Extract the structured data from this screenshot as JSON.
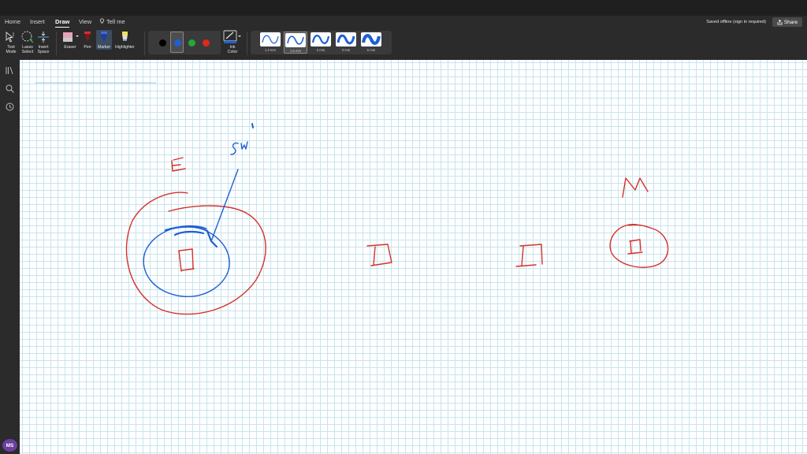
{
  "menu": {
    "tabs": [
      "Home",
      "Insert",
      "Draw",
      "View"
    ],
    "tell_me": "Tell me",
    "status": "Saved offline (sign in required)",
    "share": "Share"
  },
  "ribbon": {
    "text_mode": [
      "Text",
      "Mode"
    ],
    "lasso_select": [
      "Lasso",
      "Select"
    ],
    "insert_space": [
      "Insert",
      "Space"
    ],
    "eraser": "Eraser",
    "pen": "Pen",
    "marker": "Marker",
    "highlighter": "Highlighter",
    "ink_color": [
      "Ink",
      "Color"
    ],
    "colors": [
      "#000000",
      "#1f5fd6",
      "#22a83a",
      "#e0281c"
    ],
    "selected_color": "#1f5fd6",
    "thicknesses": [
      "1.2 mm",
      "1.5 mm",
      "2 mm",
      "3 mm",
      "5 mm"
    ],
    "selected_thickness": "1.5 mm"
  },
  "user": {
    "initials": "MS"
  },
  "ink": {
    "red": "#d6302a",
    "blue": "#1f5fd6"
  }
}
